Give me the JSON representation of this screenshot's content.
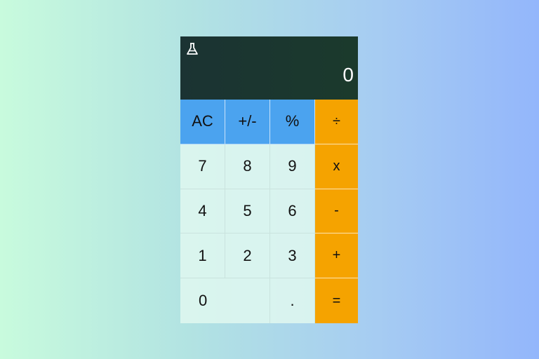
{
  "display": {
    "mode_icon": "flask-icon",
    "value": "0"
  },
  "keys": {
    "clear": "AC",
    "sign": "+/-",
    "percent": "%",
    "divide": "÷",
    "seven": "7",
    "eight": "8",
    "nine": "9",
    "multiply": "x",
    "four": "4",
    "five": "5",
    "six": "6",
    "subtract": "-",
    "one": "1",
    "two": "2",
    "three": "3",
    "add": "+",
    "zero": "0",
    "decimal": ".",
    "equals": "="
  },
  "colors": {
    "display_bg": "#1b3530",
    "function_key": "#4ba3ef",
    "number_key": "#e1f8f0",
    "operator_key": "#f5a300"
  }
}
